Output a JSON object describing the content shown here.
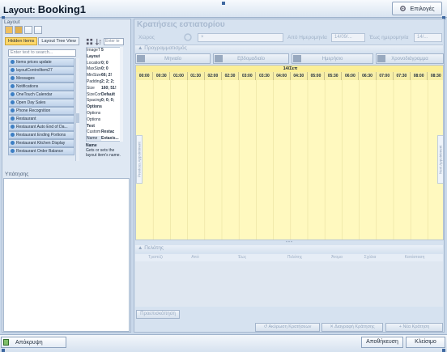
{
  "window": {
    "title_prefix": "Layout:",
    "title_name": "Booking1",
    "options_label": "Επιλογές"
  },
  "left_panel": {
    "group_label": "Layout",
    "tabs": [
      {
        "label": "Hidden Items",
        "active": true
      },
      {
        "label": "Layout Tree View",
        "active": false
      }
    ],
    "search_placeholder": "Enter text to search...",
    "items": [
      "Items prices update",
      "layoutControlItem27",
      "Messages",
      "Notifications",
      "OneTouch Calendar",
      "Open Day Sales",
      "Phone Recognition",
      "Restaurant",
      "Restaurant Auto End of Da...",
      "Restaurant Ending Portions",
      "Restaurant Kitchen Display",
      "Restaurant Order Balance"
    ],
    "props_search_placeholder": "Enter te",
    "properties": [
      {
        "k": "ImageT",
        "v": "5",
        "cat": false
      },
      {
        "k": "Layout",
        "v": "",
        "cat": true
      },
      {
        "k": "Location",
        "v": "0; 0",
        "cat": false
      },
      {
        "k": "MaxSize",
        "v": "0; 0",
        "cat": false
      },
      {
        "k": "MinSize",
        "v": "66; 2!",
        "cat": false
      },
      {
        "k": "Padding",
        "v": "2; 2; 2;",
        "cat": false
      },
      {
        "k": "Size",
        "v": "160; 51!",
        "cat": false
      },
      {
        "k": "SizeCon",
        "v": "Default",
        "cat": false
      },
      {
        "k": "Spacing",
        "v": "0; 0; 0;",
        "cat": false
      },
      {
        "k": "Options",
        "v": "",
        "cat": true
      },
      {
        "k": "Options",
        "v": "",
        "cat": false
      },
      {
        "k": "Options",
        "v": "",
        "cat": false
      },
      {
        "k": "Text",
        "v": "",
        "cat": true
      },
      {
        "k": "Custom",
        "v": "Restac",
        "cat": false
      },
      {
        "k": "Name",
        "v": "Extaxis...",
        "cat": false,
        "sel": true
      }
    ],
    "prop_help_title": "Name",
    "prop_help_text": "Gets or sets the layout item's name.",
    "description_label": "Υπάτησης"
  },
  "right_panel": {
    "title": "Κρατήσεις εστιατορίου",
    "table_label": "Χώρος",
    "table_value": "×",
    "from_label": "Από Ημερομηνία",
    "from_value": "14/09/...",
    "to_label": "Έως ημερομηνία",
    "to_value": "14/...",
    "schedule_section": "Προγραμματισμός",
    "view_buttons": [
      "Μηνιαίο",
      "Εβδομαδιαίο",
      "Ημερήσιο",
      "Χρονοδιάγραμμα"
    ],
    "calendar_date": "14/Σεπ",
    "hours": [
      "00:00",
      "00:30",
      "01:00",
      "01:30",
      "02:00",
      "02:30",
      "03:00",
      "03:30",
      "04:00",
      "04:30",
      "05:00",
      "05:30",
      "06:00",
      "06:30",
      "07:00",
      "07:30",
      "08:00",
      "08:30"
    ],
    "prev_label": "Previous Appointment",
    "next_label": "Next Appointment",
    "results_section": "Πελάτης",
    "result_columns": [
      "Τραπέζι",
      "Από",
      "Έως",
      "Πελάτης",
      "Άτομα",
      "Σχόλια",
      "Κατάσταση"
    ],
    "preview_label": "Προεπισκόπηση",
    "cancel_label": "Ακύρωση Κρατήσεων",
    "delete_label": "Διαγραφή Κράτησης",
    "new_label": "Νέα Κράτηση"
  },
  "footer": {
    "reset_label": "Απόκρυψη",
    "save_label": "Αποθήκευση",
    "close_label": "Κλείσιμο"
  },
  "colors": {
    "accent": "#3e68a0",
    "calendar_bg": "#fff9bf",
    "tab_active": "#ffd86a"
  }
}
